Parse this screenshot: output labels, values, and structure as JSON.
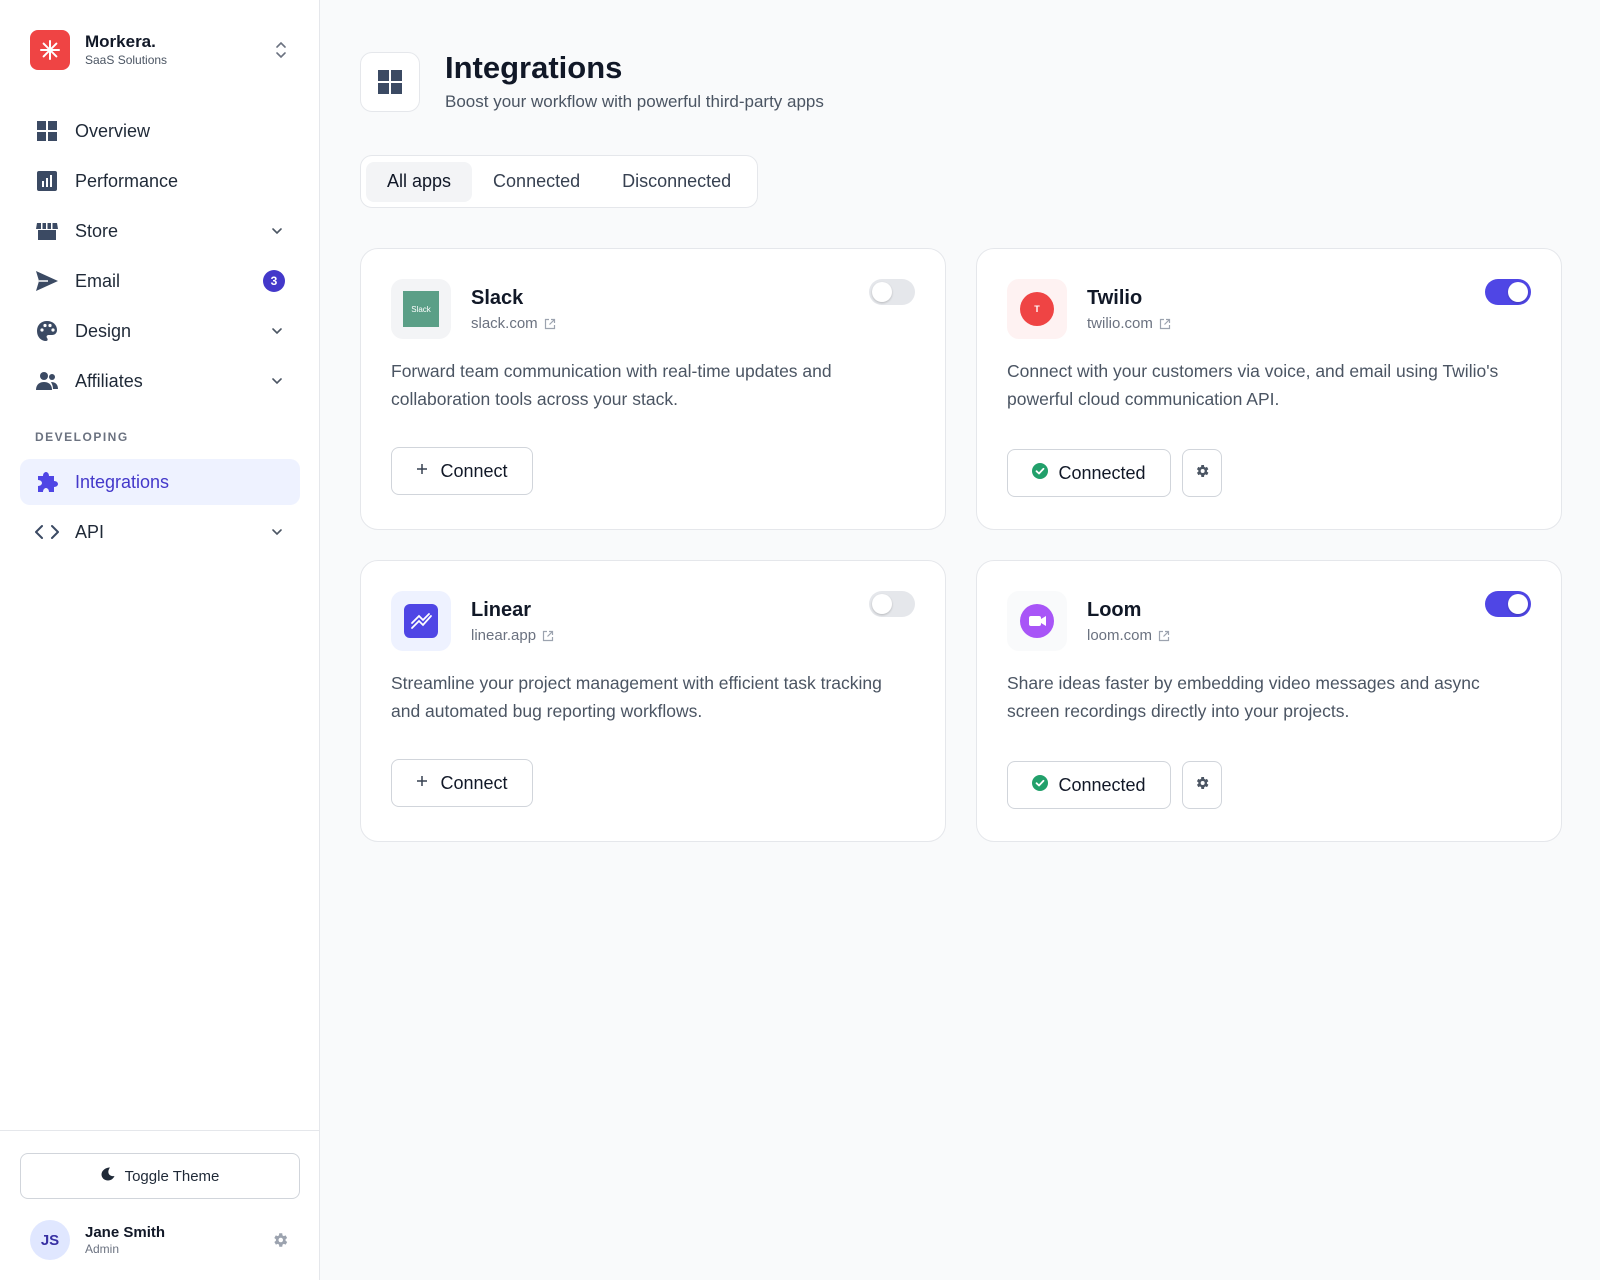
{
  "brand": {
    "name": "Morkera.",
    "subtitle": "SaaS Solutions"
  },
  "nav": {
    "items": [
      {
        "label": "Overview"
      },
      {
        "label": "Performance"
      },
      {
        "label": "Store"
      },
      {
        "label": "Email",
        "badge": "3"
      },
      {
        "label": "Design"
      },
      {
        "label": "Affiliates"
      }
    ],
    "section_label": "DEVELOPING",
    "dev_items": [
      {
        "label": "Integrations"
      },
      {
        "label": "API"
      }
    ]
  },
  "footer": {
    "toggle_theme": "Toggle Theme",
    "user": {
      "initials": "JS",
      "name": "Jane Smith",
      "role": "Admin"
    }
  },
  "header": {
    "title": "Integrations",
    "subtitle": "Boost your workflow with powerful third-party apps"
  },
  "tabs": [
    "All apps",
    "Connected",
    "Disconnected"
  ],
  "apps": [
    {
      "name": "Slack",
      "domain": "slack.com",
      "logo_text": "Slack",
      "description": "Forward team communication with real-time updates and collaboration tools across your stack.",
      "action": "Connect",
      "enabled": false
    },
    {
      "name": "Twilio",
      "domain": "twilio.com",
      "logo_text": "T",
      "description": "Connect with your customers via voice, and email using Twilio's powerful cloud communication API.",
      "action": "Connected",
      "enabled": true
    },
    {
      "name": "Linear",
      "domain": "linear.app",
      "description": "Streamline your project management with efficient task tracking and automated bug reporting workflows.",
      "action": "Connect",
      "enabled": false
    },
    {
      "name": "Loom",
      "domain": "loom.com",
      "description": "Share ideas faster by embedding video messages and async screen recordings directly into your projects.",
      "action": "Connected",
      "enabled": true
    }
  ],
  "colors": {
    "accent": "#4f46e5",
    "brand": "#ef4444",
    "success": "#22a06b",
    "slack": "#5b9f87",
    "twilio": "#ef4444",
    "linear": "#4f46e5",
    "loom": "#a855f7"
  }
}
